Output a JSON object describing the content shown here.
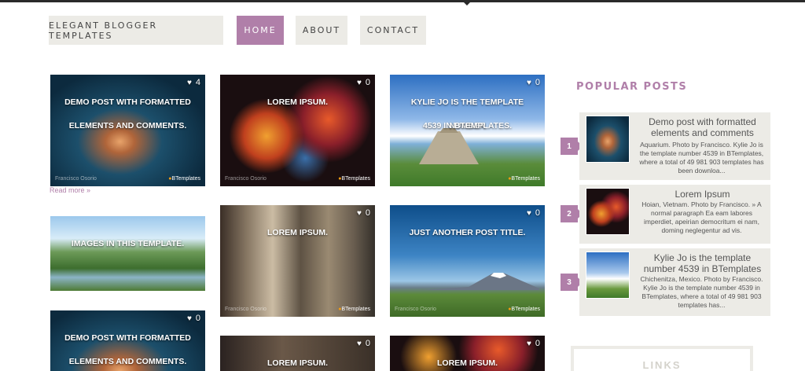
{
  "nav": {
    "brand": "ELEGANT BLOGGER TEMPLATES",
    "home": "HOME",
    "about": "ABOUT",
    "contact": "CONTACT"
  },
  "posts": [
    {
      "caption1": "DEMO POST WITH FORMATTED",
      "caption2": "ELEMENTS AND COMMENTS.",
      "likes": "4",
      "credit_left": "Francisco Osorio",
      "credit_right": "BTemplates"
    },
    {
      "caption1": "LOREM IPSUM.",
      "caption2": "",
      "likes": "0",
      "credit_left": "Francisco Osorio",
      "credit_right": "BTemplates"
    },
    {
      "caption1": "KYLIE JO IS THE TEMPLATE NUMBER",
      "caption2": "4539 IN BTEMPLATES.",
      "likes": "0",
      "credit_left": "",
      "credit_right": "BTemplates"
    },
    {
      "caption1": "IMAGES IN THIS TEMPLATE.",
      "caption2": "",
      "likes": "",
      "credit_left": "",
      "credit_right": ""
    },
    {
      "caption1": "LOREM IPSUM.",
      "caption2": "",
      "likes": "0",
      "credit_left": "Francisco Osorio",
      "credit_right": "BTemplates"
    },
    {
      "caption1": "JUST ANOTHER POST TITLE.",
      "caption2": "",
      "likes": "0",
      "credit_left": "Francisco Osorio",
      "credit_right": "BTemplates"
    },
    {
      "caption1": "DEMO POST WITH FORMATTED",
      "caption2": "ELEMENTS AND COMMENTS.",
      "likes": "0",
      "credit_left": "",
      "credit_right": ""
    },
    {
      "caption1": "LOREM IPSUM.",
      "caption2": "",
      "likes": "0",
      "credit_left": "",
      "credit_right": ""
    },
    {
      "caption1": "LOREM IPSUM.",
      "caption2": "",
      "likes": "0",
      "credit_left": "",
      "credit_right": ""
    }
  ],
  "read_more": "Read more »",
  "sidebar": {
    "title": "POPULAR POSTS",
    "popular": [
      {
        "num": "1",
        "title": "Demo post with formatted elements and comments",
        "desc": "Aquarium. Photo by Francisco. Kylie Jo is the template number 4539 in BTemplates, where a total of 49 981 903 templates has been downloa..."
      },
      {
        "num": "2",
        "title": "Lorem Ipsum",
        "desc": "Hoian, Vietnam. Photo by Francisco. » A normal paragraph Ea eam labores imperdiet, apeirian democritum ei nam, doming neglegentur ad vis."
      },
      {
        "num": "3",
        "title": "Kylie Jo is the template number 4539 in BTemplates",
        "desc": "Chichenitza, Mexico. Photo by Francisco. Kylie Jo is the template number 4539 in BTemplates, where a total of 49 981 903 templates has..."
      }
    ],
    "links_label": "LINKS"
  },
  "colors": {
    "accent": "#b07fa9",
    "nav_bg": "#ecebe6"
  }
}
